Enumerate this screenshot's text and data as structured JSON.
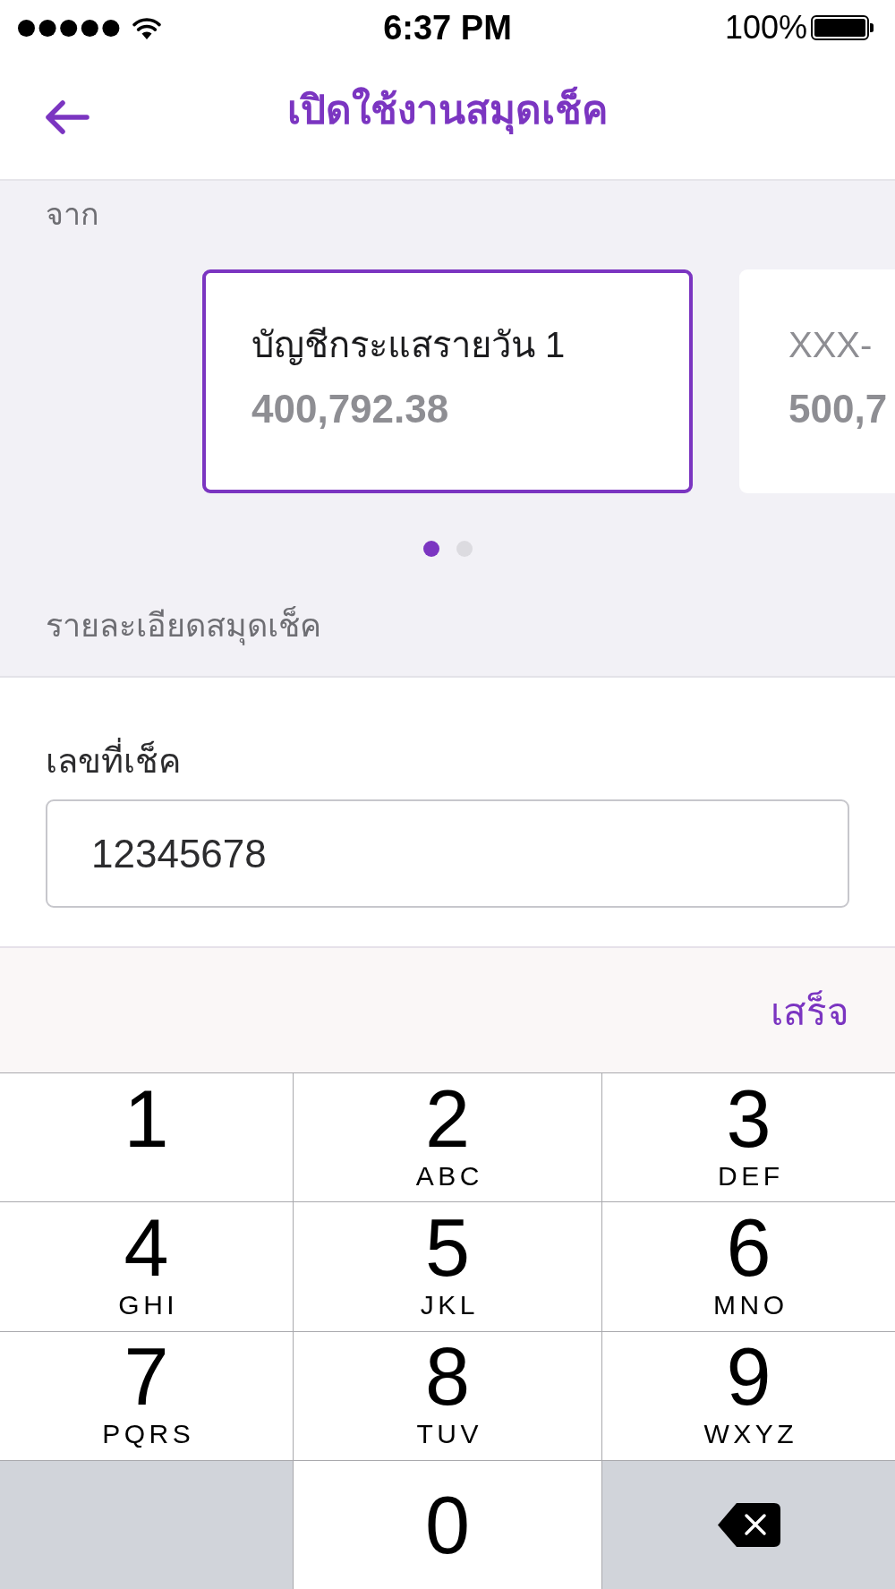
{
  "status_bar": {
    "time": "6:37 PM",
    "battery": "100%"
  },
  "nav": {
    "title": "เปิดใช้งานสมุดเช็ค"
  },
  "from_label": "จาก",
  "accounts": [
    {
      "name": "บัญชีกระแสรายวัน 1",
      "balance": "400,792.38",
      "selected": true
    },
    {
      "name": "XXX-",
      "balance": "500,7",
      "selected": false
    }
  ],
  "page_dots": [
    {
      "selected": true
    },
    {
      "selected": false
    }
  ],
  "section_label": "รายละเอียดสมุดเช็ค",
  "check_number": {
    "label": "เลขที่เช็ค",
    "value": "12345678"
  },
  "keyboard_toolbar": {
    "done": "เสร็จ"
  },
  "keypad": {
    "rows": [
      [
        {
          "kind": "digit",
          "digit": "1"
        },
        {
          "kind": "digit",
          "digit": "2",
          "letters": "ABC"
        },
        {
          "kind": "digit",
          "digit": "3",
          "letters": "DEF"
        }
      ],
      [
        {
          "kind": "digit",
          "digit": "4",
          "letters": "GHI"
        },
        {
          "kind": "digit",
          "digit": "5",
          "letters": "JKL"
        },
        {
          "kind": "digit",
          "digit": "6",
          "letters": "MNO"
        }
      ],
      [
        {
          "kind": "digit",
          "digit": "7",
          "letters": "PQRS"
        },
        {
          "kind": "digit",
          "digit": "8",
          "letters": "TUV"
        },
        {
          "kind": "digit",
          "digit": "9",
          "letters": "WXYZ"
        }
      ],
      [
        {
          "kind": "blank"
        },
        {
          "kind": "digit",
          "digit": "0"
        },
        {
          "kind": "delete"
        }
      ]
    ]
  }
}
